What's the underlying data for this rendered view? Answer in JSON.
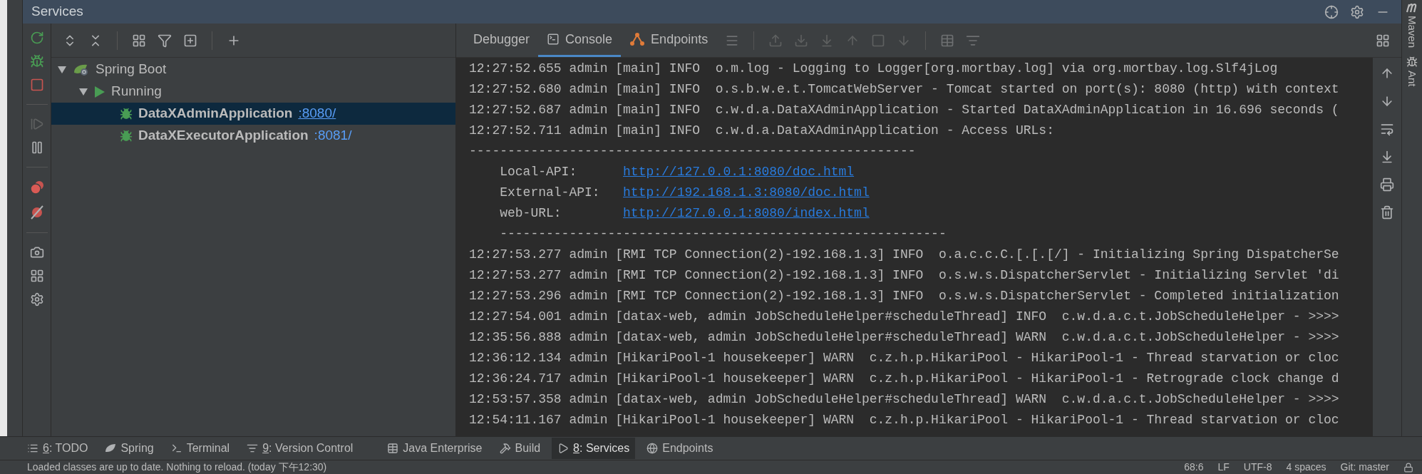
{
  "panel": {
    "title": "Services"
  },
  "tree": [
    {
      "kind": "spring",
      "label": "Spring Boot",
      "expanded": true,
      "children": [
        {
          "kind": "running",
          "label": "Running",
          "expanded": true,
          "children": [
            {
              "kind": "app",
              "label": "DataXAdminApplication",
              "port": ":8080/",
              "selected": true
            },
            {
              "kind": "app",
              "label": "DataXExecutorApplication",
              "port": ":8081/",
              "selected": false
            }
          ]
        }
      ]
    }
  ],
  "tabs": [
    {
      "kind": "plain",
      "label": "Debugger",
      "selected": false
    },
    {
      "kind": "console",
      "label": "Console",
      "selected": true
    },
    {
      "kind": "endpoints",
      "label": "Endpoints",
      "selected": false
    }
  ],
  "console": [
    {
      "kind": "log",
      "text": "12:27:52.655 admin [main] INFO  o.m.log - Logging to Logger[org.mortbay.log] via org.mortbay.log.Slf4jLog"
    },
    {
      "kind": "log",
      "text": "12:27:52.680 admin [main] INFO  o.s.b.w.e.t.TomcatWebServer - Tomcat started on port(s): 8080 (http) with context"
    },
    {
      "kind": "log",
      "text": "12:27:52.687 admin [main] INFO  c.w.d.a.DataXAdminApplication - Started DataXAdminApplication in 16.696 seconds ("
    },
    {
      "kind": "log",
      "text": "12:27:52.711 admin [main] INFO  c.w.d.a.DataXAdminApplication - Access URLs:"
    },
    {
      "kind": "rule",
      "indented": false,
      "text": "----------------------------------------------------------"
    },
    {
      "kind": "url",
      "label": "Local-API:",
      "link": "http://127.0.0.1:8080/doc.html"
    },
    {
      "kind": "url",
      "label": "External-API:",
      "link": "http://192.168.1.3:8080/doc.html"
    },
    {
      "kind": "url",
      "label": "web-URL:",
      "link": "http://127.0.0.1:8080/index.html"
    },
    {
      "kind": "rule",
      "indented": true,
      "text": "----------------------------------------------------------"
    },
    {
      "kind": "log",
      "text": "12:27:53.277 admin [RMI TCP Connection(2)-192.168.1.3] INFO  o.a.c.c.C.[.[.[/] - Initializing Spring DispatcherSe"
    },
    {
      "kind": "log",
      "text": "12:27:53.277 admin [RMI TCP Connection(2)-192.168.1.3] INFO  o.s.w.s.DispatcherServlet - Initializing Servlet 'di"
    },
    {
      "kind": "log",
      "text": "12:27:53.296 admin [RMI TCP Connection(2)-192.168.1.3] INFO  o.s.w.s.DispatcherServlet - Completed initialization"
    },
    {
      "kind": "log",
      "text": "12:27:54.001 admin [datax-web, admin JobScheduleHelper#scheduleThread] INFO  c.w.d.a.c.t.JobScheduleHelper - >>>>"
    },
    {
      "kind": "log",
      "text": "12:35:56.888 admin [datax-web, admin JobScheduleHelper#scheduleThread] WARN  c.w.d.a.c.t.JobScheduleHelper - >>>>"
    },
    {
      "kind": "log",
      "text": "12:36:12.134 admin [HikariPool-1 housekeeper] WARN  c.z.h.p.HikariPool - HikariPool-1 - Thread starvation or cloc"
    },
    {
      "kind": "log",
      "text": "12:36:24.717 admin [HikariPool-1 housekeeper] WARN  c.z.h.p.HikariPool - HikariPool-1 - Retrograde clock change d"
    },
    {
      "kind": "log",
      "text": "12:53:57.358 admin [datax-web, admin JobScheduleHelper#scheduleThread] WARN  c.w.d.a.c.t.JobScheduleHelper - >>>>"
    },
    {
      "kind": "log",
      "text": "12:54:11.167 admin [HikariPool-1 housekeeper] WARN  c.z.h.p.HikariPool - HikariPool-1 - Thread starvation or cloc"
    }
  ],
  "side_stripe": [
    {
      "kind": "maven",
      "label": "Maven"
    },
    {
      "kind": "ant",
      "label": "Ant"
    }
  ],
  "tool_windows": [
    {
      "kind": "todo",
      "key": "6",
      "label": ": TODO",
      "selected": false
    },
    {
      "kind": "spring",
      "label": "Spring",
      "selected": false
    },
    {
      "kind": "terminal",
      "label": "Terminal",
      "selected": false
    },
    {
      "kind": "vcs",
      "key": "9",
      "label": ": Version Control",
      "selected": false
    },
    {
      "kind": "javaee",
      "label": "Java Enterprise",
      "selected": false
    },
    {
      "kind": "build",
      "label": "Build",
      "selected": false
    },
    {
      "kind": "services",
      "key": "8",
      "label": ": Services",
      "selected": true
    },
    {
      "kind": "endpoints",
      "label": "Endpoints",
      "selected": false
    }
  ],
  "status_bar": {
    "message": "Loaded classes are up to date. Nothing to reload. (today 下午12:30)",
    "items": [
      "68:6",
      "LF",
      "UTF-8",
      "4 spaces",
      "Git: master"
    ]
  }
}
